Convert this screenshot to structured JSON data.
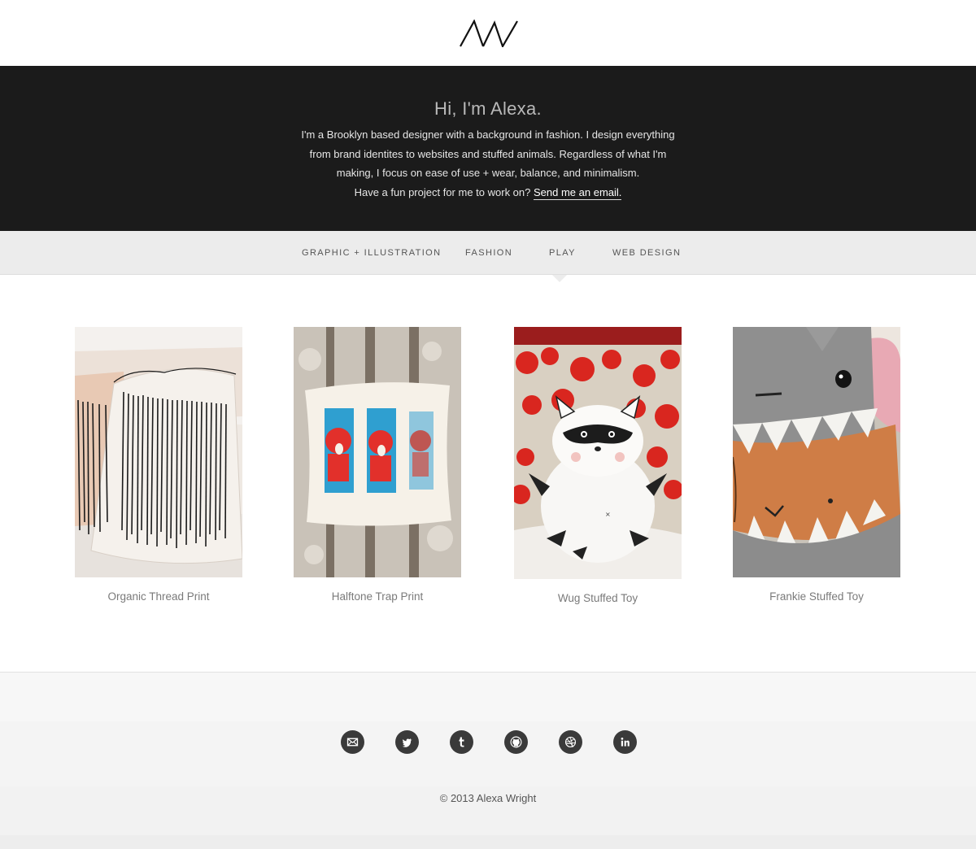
{
  "header": {
    "logo_icon": "aw-monogram-logo",
    "logo_text": "AW"
  },
  "hero": {
    "title": "Hi, I'm Alexa.",
    "lines": [
      "I'm a Brooklyn based designer with a background in fashion. I design everything",
      "from brand identites to websites and stuffed animals. Regardless of what I'm",
      "making, I focus on ease of use + wear, balance, and minimalism."
    ],
    "cta_prefix": "Have a fun project for me to work on?",
    "cta_link": "Send me an email."
  },
  "nav": {
    "items": [
      "GRAPHIC + ILLUSTRATION",
      "FASHION",
      "PLAY",
      "WEB DESIGN"
    ],
    "active": "PLAY"
  },
  "portfolio": {
    "items": [
      {
        "title": "Organic Thread Print"
      },
      {
        "title": "Halftone Trap Print"
      },
      {
        "title": "Wug Stuffed Toy"
      },
      {
        "title": "Frankie Stuffed Toy"
      }
    ]
  },
  "footer": {
    "social_icons": [
      "email-icon",
      "twitter-icon",
      "tumblr-icon",
      "github-icon",
      "dribbble-icon",
      "linkedin-icon"
    ],
    "copyright": "© 2013 Alexa Wright"
  },
  "colors": {
    "hero_bg": "#1b1b1b",
    "nav_bg": "#ececec",
    "footer_bg": "#f5f5f5",
    "icon": "#3a3a3a"
  }
}
